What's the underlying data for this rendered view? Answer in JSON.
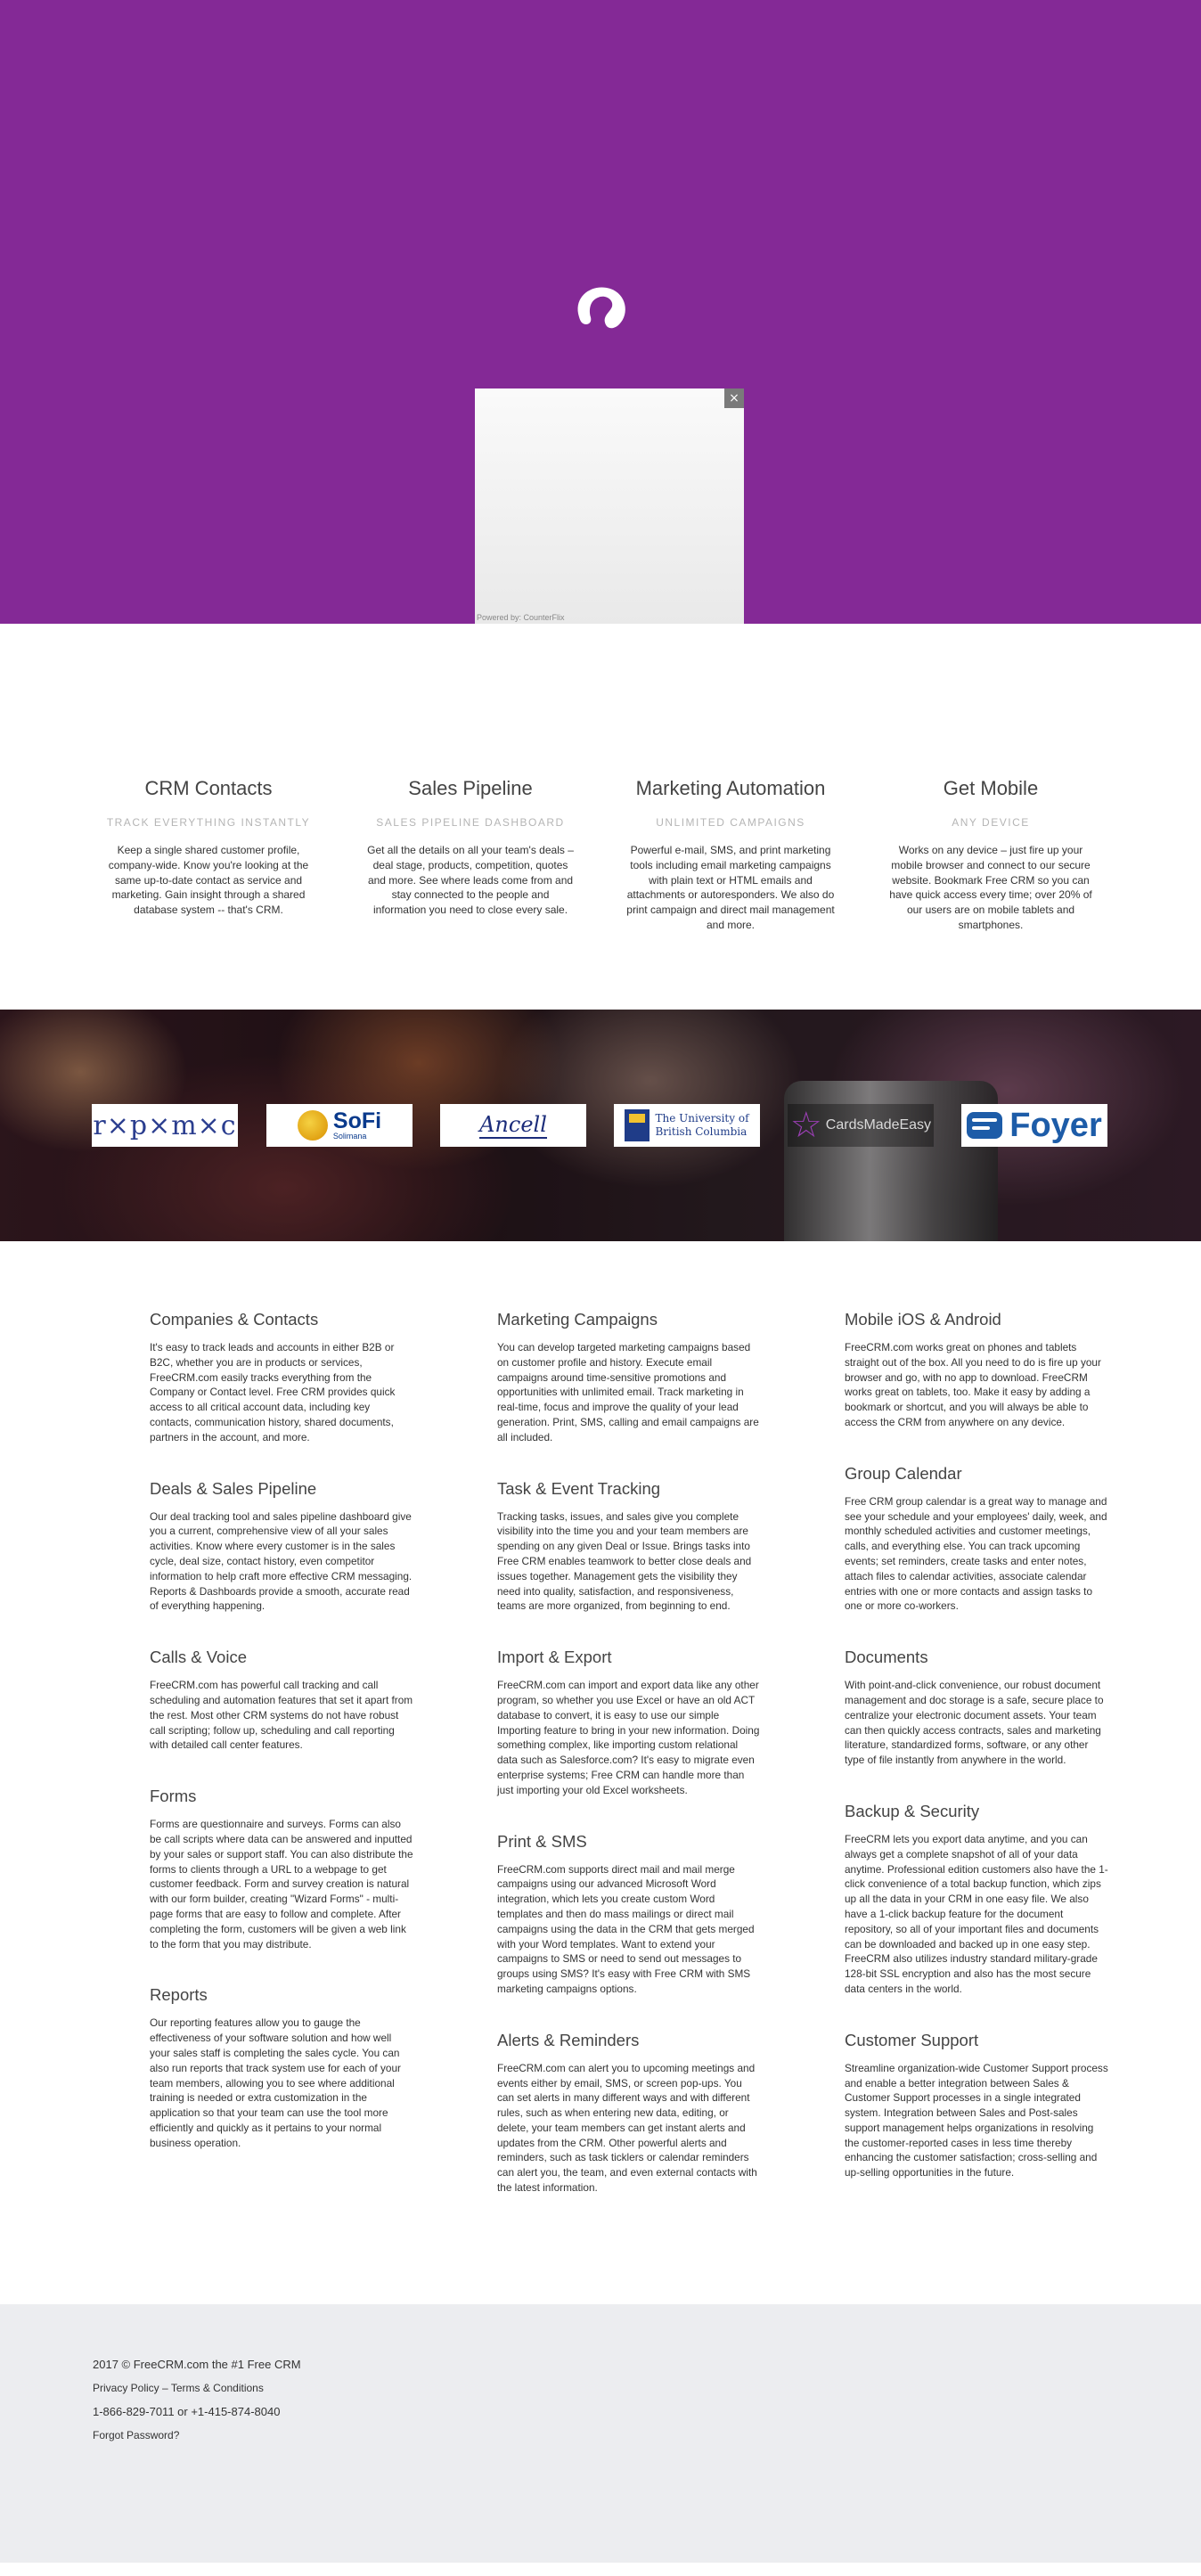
{
  "hero": {
    "background_color": "#842996",
    "logo_icon": "freecrm-swirl-icon",
    "popup": {
      "close_label": "×",
      "powered_by": "Powered by: CounterFlix"
    }
  },
  "features": [
    {
      "title": "CRM Contacts",
      "subtitle": "TRACK EVERYTHING INSTANTLY",
      "text": "Keep a single shared customer profile, company-wide. Know you're looking at the same up-to-date contact as service and marketing. Gain insight through a shared database system -- that's CRM."
    },
    {
      "title": "Sales Pipeline",
      "subtitle": "SALES PIPELINE DASHBOARD",
      "text": "Get all the details on all your team's deals – deal stage, products, competition, quotes and more. See where leads come from and stay connected to the people and information you need to close every sale."
    },
    {
      "title": "Marketing Automation",
      "subtitle": "UNLIMITED CAMPAIGNS",
      "text": "Powerful e-mail, SMS, and print marketing tools including email marketing campaigns with plain text or HTML emails and attachments or autoresponders. We also do print campaign and direct mail management and more."
    },
    {
      "title": "Get Mobile",
      "subtitle": "ANY DEVICE",
      "text": "Works on any device – just fire up your mobile browser and connect to our secure website. Bookmark Free CRM so you can have quick access every time; over 20% of our users are on mobile tablets and smartphones."
    }
  ],
  "client_logos": {
    "rpmc": "r×p×m×c",
    "sofi_name": "SoFi",
    "sofi_tag": "Solimana",
    "ancell": "Ancell",
    "ubc_line1": "The University of",
    "ubc_line2": "British Columbia",
    "cards": "CardsMadeEasy",
    "foyer": "Foyer"
  },
  "details": {
    "col1": [
      {
        "title": "Companies & Contacts",
        "text": "It's easy to track leads and accounts in either B2B or B2C, whether you are in products or services, FreeCRM.com easily tracks everything from the Company or Contact level. Free CRM provides quick access to all critical account data, including key contacts, communication history, shared documents, partners in the account, and more."
      },
      {
        "title": "Deals & Sales Pipeline",
        "text": "Our deal tracking tool and sales pipeline dashboard give you a current, comprehensive view of all your sales activities. Know where every customer is in the sales cycle, deal size, contact history, even competitor information to help craft more effective CRM messaging. Reports & Dashboards provide a smooth, accurate read of everything happening."
      },
      {
        "title": "Calls & Voice",
        "text": "FreeCRM.com has powerful call tracking and call scheduling and automation features that set it apart from the rest. Most other CRM systems do not have robust call scripting; follow up, scheduling and call reporting with detailed call center features."
      },
      {
        "title": "Forms",
        "text": "Forms are questionnaire and surveys. Forms can also be call scripts where data can be answered and inputted by your sales or support staff. You can also distribute the forms to clients through a URL to a webpage to get customer feedback. Form and survey creation is natural with our form builder, creating \"Wizard Forms\" - multi-page forms that are easy to follow and complete. After completing the form, customers will be given a web link to the form that you may distribute."
      },
      {
        "title": "Reports",
        "text": "Our reporting features allow you to gauge the effectiveness of your software solution and how well your sales staff is completing the sales cycle. You can also run reports that track system use for each of your team members, allowing you to see where additional training is needed or extra customization in the application so that your team can use the tool more efficiently and quickly as it pertains to your normal business operation."
      }
    ],
    "col2": [
      {
        "title": "Marketing Campaigns",
        "text": "You can develop targeted marketing campaigns based on customer profile and history. Execute email campaigns around time-sensitive promotions and opportunities with unlimited email. Track marketing in real-time, focus and improve the quality of your lead generation. Print, SMS, calling and email campaigns are all included."
      },
      {
        "title": "Task & Event Tracking",
        "text": "Tracking tasks, issues, and sales give you complete visibility into the time you and your team members are spending on any given Deal or Issue. Brings tasks into Free CRM enables teamwork to better close deals and issues together. Management gets the visibility they need into quality, satisfaction, and responsiveness, teams are more organized, from beginning to end."
      },
      {
        "title": "Import & Export",
        "text": "FreeCRM.com can import and export data like any other program, so whether you use Excel or have an old ACT database to convert, it is easy to use our simple Importing feature to bring in your new information. Doing something complex, like importing custom relational data such as Salesforce.com? It's easy to migrate even enterprise systems; Free CRM can handle more than just importing your old Excel worksheets."
      },
      {
        "title": "Print & SMS",
        "text": "FreeCRM.com supports direct mail and mail merge campaigns using our advanced Microsoft Word integration, which lets you create custom Word templates and then do mass mailings or direct mail campaigns using the data in the CRM that gets merged with your Word templates. Want to extend your campaigns to SMS or need to send out messages to groups using SMS? It's easy with Free CRM with SMS marketing campaigns options."
      },
      {
        "title": "Alerts & Reminders",
        "text": "FreeCRM.com can alert you to upcoming meetings and events either by email, SMS, or screen pop-ups. You can set alerts in many different ways and with different rules, such as when entering new data, editing, or delete, your team members can get instant alerts and updates from the CRM. Other powerful alerts and reminders, such as task ticklers or calendar reminders can alert you, the team, and even external contacts with the latest information."
      }
    ],
    "col3": [
      {
        "title": "Mobile iOS & Android",
        "text": "FreeCRM.com works great on phones and tablets straight out of the box. All you need to do is fire up your browser and go, with no app to download. FreeCRM works great on tablets, too. Make it easy by adding a bookmark or shortcut, and you will always be able to access the CRM from anywhere on any device."
      },
      {
        "title": "Group Calendar",
        "text": "Free CRM group calendar is a great way to manage and see your schedule and your employees' daily, week, and monthly scheduled activities and customer meetings, calls, and everything else. You can track upcoming events; set reminders, create tasks and enter notes, attach files to calendar activities, associate calendar entries with one or more contacts and assign tasks to one or more co-workers."
      },
      {
        "title": "Documents",
        "text": "With point-and-click convenience, our robust document management and doc storage is a safe, secure place to centralize your electronic document assets. Your team can then quickly access contracts, sales and marketing literature, standardized forms, software, or any other type of file instantly from anywhere in the world."
      },
      {
        "title": "Backup & Security",
        "text": "FreeCRM lets you export data anytime, and you can always get a complete snapshot of all of your data anytime. Professional edition customers also have the 1-click convenience of a total backup function, which zips up all the data in your CRM in one easy file. We also have a 1-click backup feature for the document repository, so all of your important files and documents can be downloaded and backed up in one easy step. FreeCRM also utilizes industry standard military-grade 128-bit SSL encryption and also has the most secure data centers in the world."
      },
      {
        "title": "Customer Support",
        "text": "Streamline organization-wide Customer Support process and enable a better integration between Sales & Customer Support processes in a single integrated system. Integration between Sales and Post-sales support management helps organizations in resolving the customer-reported cases in less time thereby enhancing the customer satisfaction; cross-selling and up-selling opportunities in the future."
      }
    ]
  },
  "footer": {
    "copyright": "2017 © FreeCRM.com the #1 Free CRM",
    "privacy_label": "Privacy Policy",
    "separator": " – ",
    "terms_label": "Terms & Conditions",
    "phone": "1-866-829-7011 or +1-415-874-8040",
    "forgot_password": "Forgot Password?"
  }
}
